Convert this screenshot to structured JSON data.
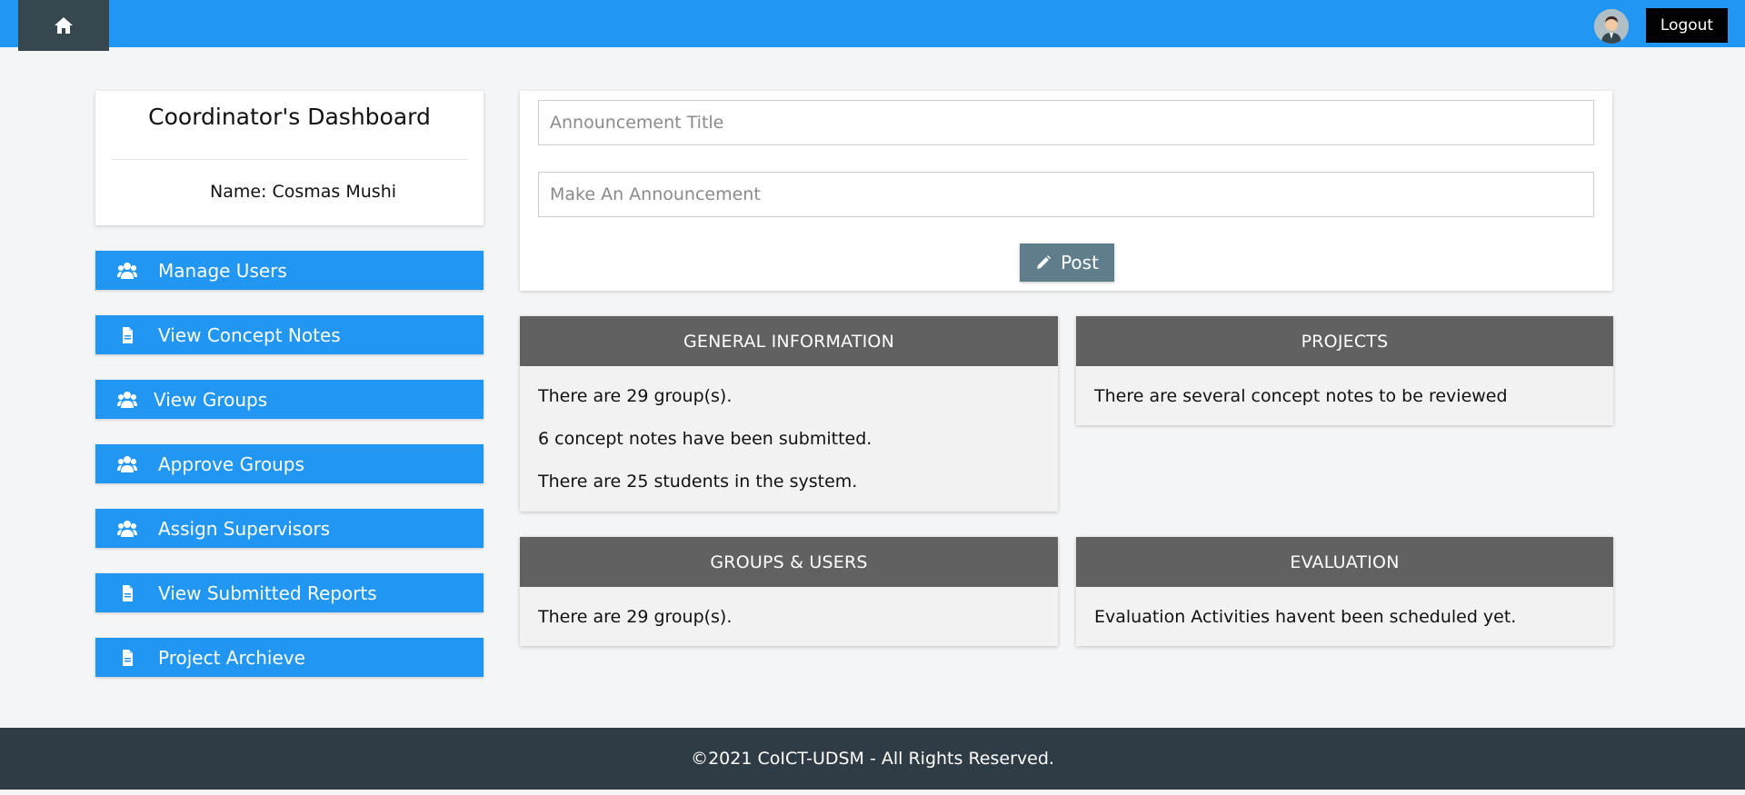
{
  "topbar": {
    "home_icon": "home-icon",
    "avatar_icon": "user-avatar",
    "logout_label": "Logout"
  },
  "profile": {
    "title": "Coordinator's Dashboard",
    "name": "Name: Cosmas Mushi"
  },
  "menu": {
    "items": [
      {
        "label": "Manage Users",
        "icon": "users-icon"
      },
      {
        "label": "View Concept Notes",
        "icon": "document-icon"
      },
      {
        "label": "View Groups",
        "icon": "users-icon"
      },
      {
        "label": "Approve Groups",
        "icon": "users-icon"
      },
      {
        "label": "Assign Supervisors",
        "icon": "users-icon"
      },
      {
        "label": "View Submitted Reports",
        "icon": "document-icon"
      },
      {
        "label": "Project Archieve",
        "icon": "document-icon"
      }
    ]
  },
  "announcement": {
    "title_placeholder": "Announcement Title",
    "body_placeholder": "Make An Announcement",
    "post_label": "Post",
    "post_icon": "pencil-icon"
  },
  "cards": {
    "general": {
      "header": "GENERAL INFORMATION",
      "lines": [
        "There are 29 group(s).",
        "6 concept notes have been submitted.",
        "There are 25 students in the system."
      ]
    },
    "projects": {
      "header": "PROJECTS",
      "lines": [
        "There are several concept notes to be reviewed"
      ]
    },
    "groups_users": {
      "header": "GROUPS & USERS",
      "lines": [
        "There are 29 group(s)."
      ]
    },
    "evaluation": {
      "header": "EVALUATION",
      "lines": [
        "Evaluation Activities havent been scheduled yet."
      ]
    }
  },
  "footer": {
    "text": "©2021 CoICT-UDSM - All Rights Reserved."
  },
  "colors": {
    "primary": "#2196f3",
    "dark": "#37474f",
    "card_header": "#616161",
    "post_button": "#607d8b",
    "footer": "#2f3c45",
    "background": "#f4f5f7"
  }
}
